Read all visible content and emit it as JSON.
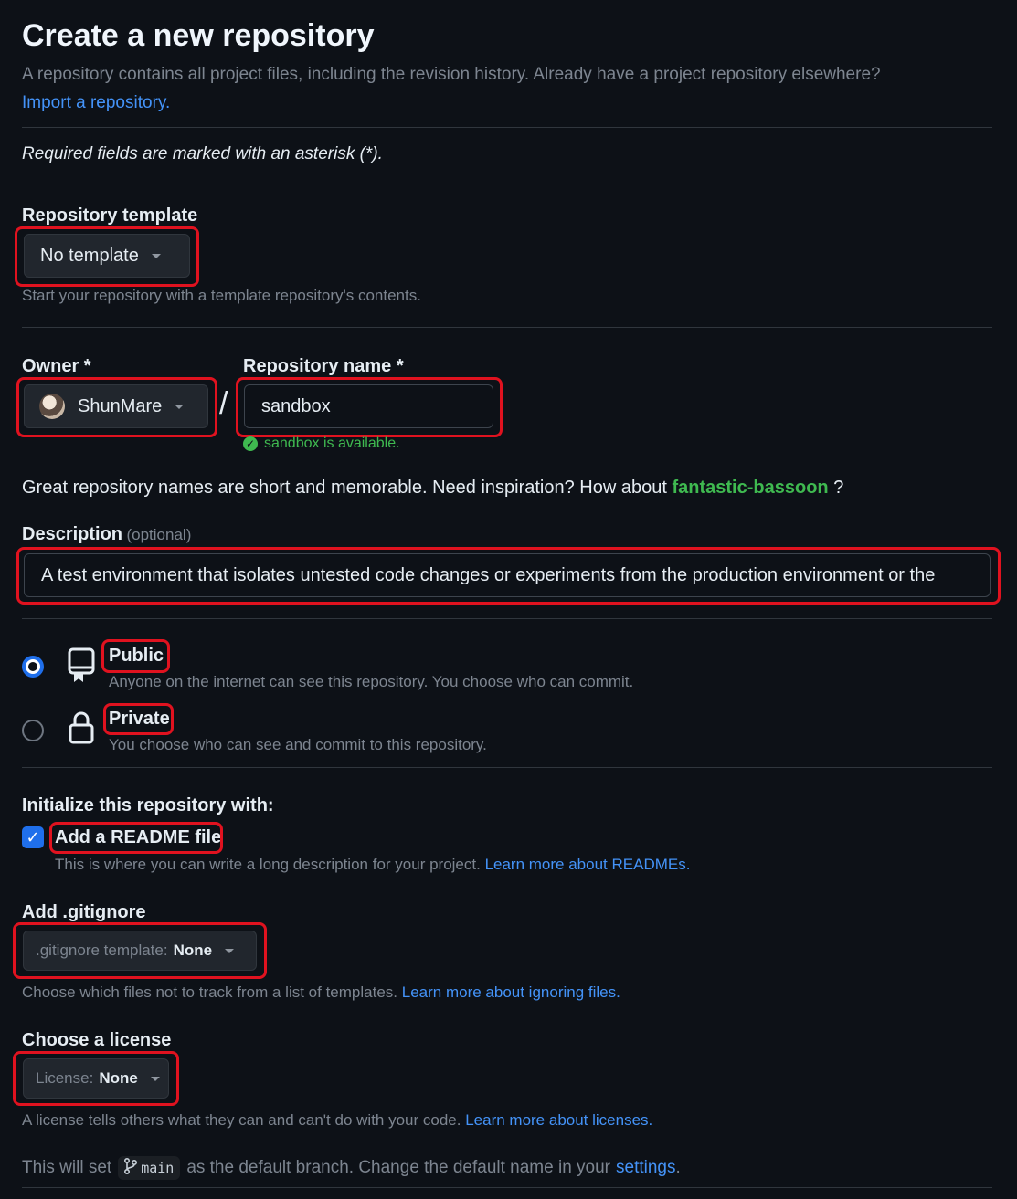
{
  "header": {
    "title": "Create a new repository",
    "subtitle": "A repository contains all project files, including the revision history. Already have a project repository elsewhere?",
    "import_link": "Import a repository.",
    "required_note": "Required fields are marked with an asterisk (*)."
  },
  "template": {
    "label": "Repository template",
    "value": "No template",
    "hint": "Start your repository with a template repository's contents."
  },
  "owner": {
    "label": "Owner *",
    "value": "ShunMare"
  },
  "repo_name": {
    "label": "Repository name *",
    "value": "sandbox",
    "available": "sandbox is available."
  },
  "inspiration": {
    "text": "Great repository names are short and memorable. Need inspiration? How about",
    "suggestion": "fantastic-bassoon",
    "suffix": "?"
  },
  "description": {
    "label": "Description",
    "optional": "(optional)",
    "value": "A test environment that isolates untested code changes or experiments from the production environment or the"
  },
  "visibility": {
    "public_label": "Public",
    "public_hint": "Anyone on the internet can see this repository. You choose who can commit.",
    "private_label": "Private",
    "private_hint": "You choose who can see and commit to this repository.",
    "selected": "Public"
  },
  "init": {
    "heading": "Initialize this repository with:",
    "readme_label": "Add a README file",
    "readme_checked": true,
    "readme_hint": "This is where you can write a long description for your project.",
    "readme_link": "Learn more about READMEs."
  },
  "gitignore": {
    "label": "Add .gitignore",
    "prefix": ".gitignore template:",
    "value": "None",
    "hint": "Choose which files not to track from a list of templates.",
    "link": "Learn more about ignoring files."
  },
  "license": {
    "label": "Choose a license",
    "prefix": "License:",
    "value": "None",
    "hint": "A license tells others what they can and can't do with your code.",
    "link": "Learn more about licenses."
  },
  "branch": {
    "before": "This will set",
    "name": "main",
    "after": "as the default branch. Change the default name in your",
    "link": "settings",
    "end": "."
  },
  "colors": {
    "background": "#0d1117",
    "accent": "#4493f8",
    "success": "#3fb950",
    "highlight": "#e0121f"
  }
}
